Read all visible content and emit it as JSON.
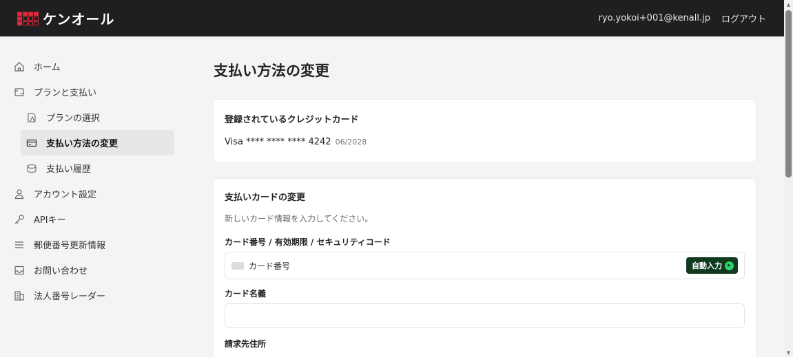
{
  "header": {
    "logo_text": "ケンオール",
    "user_email": "ryo.yokoi+001@kenall.jp",
    "logout_label": "ログアウト"
  },
  "sidebar": {
    "items": [
      {
        "label": "ホーム",
        "icon": "home-icon"
      },
      {
        "label": "プランと支払い",
        "icon": "plan-icon"
      },
      {
        "label": "プランの選択",
        "icon": "select-plan-icon"
      },
      {
        "label": "支払い方法の変更",
        "icon": "credit-card-icon"
      },
      {
        "label": "支払い履歴",
        "icon": "history-icon"
      },
      {
        "label": "アカウント設定",
        "icon": "user-icon"
      },
      {
        "label": "APIキー",
        "icon": "key-icon"
      },
      {
        "label": "郵便番号更新情報",
        "icon": "list-icon"
      },
      {
        "label": "お問い合わせ",
        "icon": "inbox-icon"
      },
      {
        "label": "法人番号レーダー",
        "icon": "building-icon"
      }
    ]
  },
  "main": {
    "title": "支払い方法の変更",
    "current_card": {
      "heading": "登録されているクレジットカード",
      "brand_and_number": "Visa **** **** **** 4242",
      "expiry": "06/2028"
    },
    "change_card": {
      "heading": "支払いカードの変更",
      "hint": "新しいカード情報を入力してください。",
      "card_field_label": "カード番号 / 有効期限 / セキュリティコード",
      "card_placeholder": "カード番号",
      "autofill_label": "自動入力",
      "name_field_label": "カード名義",
      "next_field_label": "請求先住所"
    }
  },
  "colors": {
    "topbar": "#1f1f1f",
    "logo_red": "#e0283b",
    "autofill_bg": "#0f3a1e",
    "autofill_accent": "#2bd46a"
  }
}
